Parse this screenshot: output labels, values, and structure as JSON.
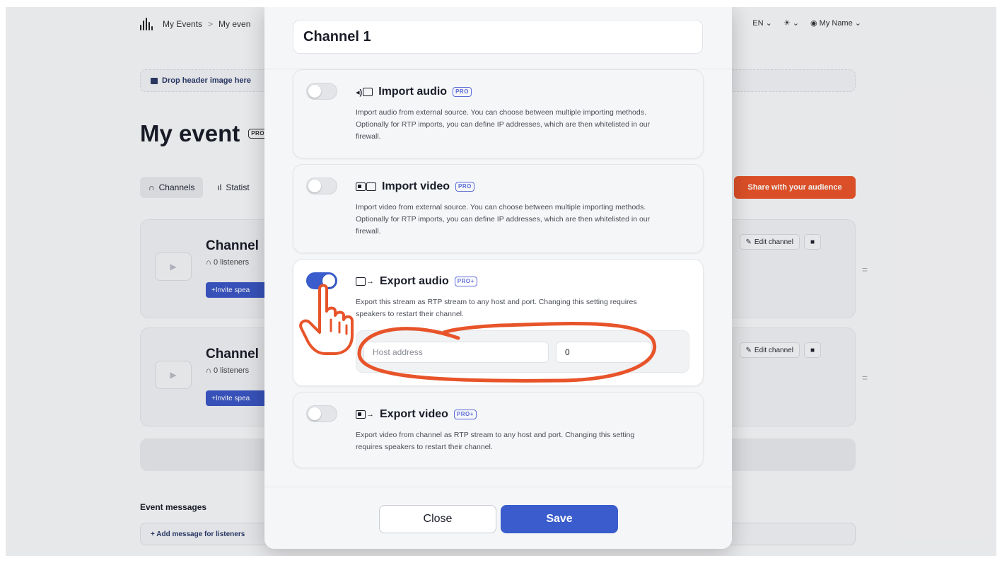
{
  "nav": {
    "breadcrumb_root": "My Events",
    "breadcrumb_sep": ">",
    "breadcrumb_current": "My even",
    "language": "EN",
    "user": "My Name"
  },
  "header": {
    "drop_image": "Drop header image here",
    "event_title": "My event",
    "event_badge": "PRO",
    "tab_channels": "Channels",
    "tab_stats": "Statist",
    "share_button": "Share with your audience"
  },
  "channels": [
    {
      "name": "Channel",
      "listeners": "0 listeners",
      "invite": "Invite spea",
      "edit": "Edit channel"
    },
    {
      "name": "Channel",
      "listeners": "0 listeners",
      "invite": "Invite spea",
      "edit": "Edit channel"
    }
  ],
  "event_messages": {
    "title": "Event messages",
    "add": "+ Add message for listeners"
  },
  "modal": {
    "channel_title": "Channel 1",
    "options": [
      {
        "title": "Import audio",
        "badge": "PRO",
        "enabled": false,
        "icon": "import-audio-icon",
        "description": "Import audio from external source. You can choose between multiple importing methods. Optionally for RTP imports, you can define IP addresses, which are then whitelisted in our firewall."
      },
      {
        "title": "Import video",
        "badge": "PRO",
        "enabled": false,
        "icon": "import-video-icon",
        "description": "Import video from external source. You can choose between multiple importing methods. Optionally for RTP imports, you can define IP addresses, which are then whitelisted in our firewall."
      },
      {
        "title": "Export audio",
        "badge": "PRO+",
        "enabled": true,
        "icon": "export-audio-icon",
        "description": "Export this stream as RTP stream to any host and port. Changing this setting requires speakers to restart their channel."
      },
      {
        "title": "Export video",
        "badge": "PRO+",
        "enabled": false,
        "icon": "export-video-icon",
        "description": "Export video from channel as RTP stream to any host and port. Changing this setting requires speakers to restart their channel."
      }
    ],
    "host_placeholder": "Host address",
    "port_value": "0",
    "close_label": "Close",
    "save_label": "Save"
  },
  "colors": {
    "accent": "#3a5ccc",
    "share": "#e8542a",
    "annotation": "#e8542a"
  }
}
